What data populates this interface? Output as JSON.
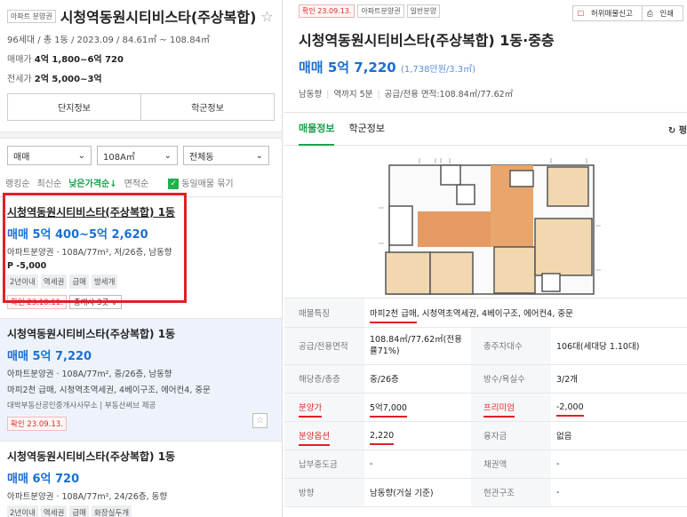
{
  "left": {
    "tag": "아파트 분양권",
    "title": "시청역동원시티비스타(주상복합)",
    "meta": "96세대 / 총 1동 / 2023.09 / 84.61㎡ ~ 108.84㎡",
    "sale_label": "매매가",
    "sale_value": "4억 1,800~6억 720",
    "jeonse_label": "전세가",
    "jeonse_value": "2억 5,000~3억",
    "btn_complex": "단지정보",
    "btn_school": "학군정보",
    "filter_type": "매매",
    "filter_area": "108A㎡",
    "filter_dong": "전체동",
    "sort_ranking": "랭킹순",
    "sort_latest": "최신순",
    "sort_low_price": "낮은가격순",
    "sort_area": "면적순",
    "group_same": "동일매물 묶기",
    "cards": [
      {
        "title": "시청역동원시티비스타(주상복합) 1동",
        "price": "매매 5억 400~5억 2,620",
        "info": "아파트분양권 · 108A/77m², 저/26층, 남동향",
        "extra": "P -5,000",
        "chips": [
          "2년이내",
          "역세권",
          "급매",
          "방세개"
        ],
        "date": "확인 23.10.11.",
        "agent": "중개사 3곳"
      },
      {
        "title": "시청역동원시티비스타(주상복합) 1동",
        "price": "매매 5억 7,220",
        "info": "아파트분양권 · 108A/77m², 중/26층, 남동향",
        "desc": "마피2천 급매, 시청역초역세권, 4베이구조, 에어컨4, 중문",
        "source": "대박부동산공인중개사사무소 | 부동산써브 제공",
        "date": "확인 23.09.13."
      },
      {
        "title": "시청역동원시티비스타(주상복합) 1동",
        "price": "매매 6억 720",
        "info": "아파트분양권 · 108A/77m², 24/26층, 동향",
        "chips": [
          "2년이내",
          "역세권",
          "급매",
          "화장실두개"
        ]
      }
    ]
  },
  "right": {
    "tags": [
      "확인 23.09.13.",
      "아파트분양권",
      "일반분양"
    ],
    "report": "허위매물신고",
    "print": "인쇄",
    "title": "시청역동원시티비스타(주상복합) 1동·중층",
    "price": "매매 5억 7,220",
    "price_sub": "(1,738만원/3.3㎡)",
    "meta": [
      "남동향",
      "역까지 5분",
      "공급/전용 면적:108.84㎡/77.62㎡"
    ],
    "tab_listing": "매물정보",
    "tab_school": "학군정보",
    "refresh": "펑",
    "rows": [
      {
        "k": "매물특징",
        "v": "마피2천 급매, 시청역초역세권, 4베이구조, 에어컨4, 중문"
      },
      {
        "k": "공급/전용면적",
        "v": "108.84㎡/77.62㎡(전용률71%)",
        "k2": "총주차대수",
        "v2": "106대(세대당 1.10대)"
      },
      {
        "k": "해당층/총층",
        "v": "중/26층",
        "k2": "방수/욕실수",
        "v2": "3/2개"
      },
      {
        "k": "분양가",
        "v": "5억7,000",
        "k2": "프리미엄",
        "v2": "-2,000"
      },
      {
        "k": "분양옵션",
        "v": "2,220",
        "k2": "융자금",
        "v2": "없음"
      },
      {
        "k": "납부중도금",
        "v": "-",
        "k2": "채권액",
        "v2": "-"
      },
      {
        "k": "방향",
        "v": "남동향(거실 기준)",
        "k2": "현관구조",
        "v2": "-"
      }
    ],
    "feature_highlight": "마피2천 급매",
    "feature_rest": ", 시청역초역세권, 4베이구조, 에어컨4, 중문"
  }
}
